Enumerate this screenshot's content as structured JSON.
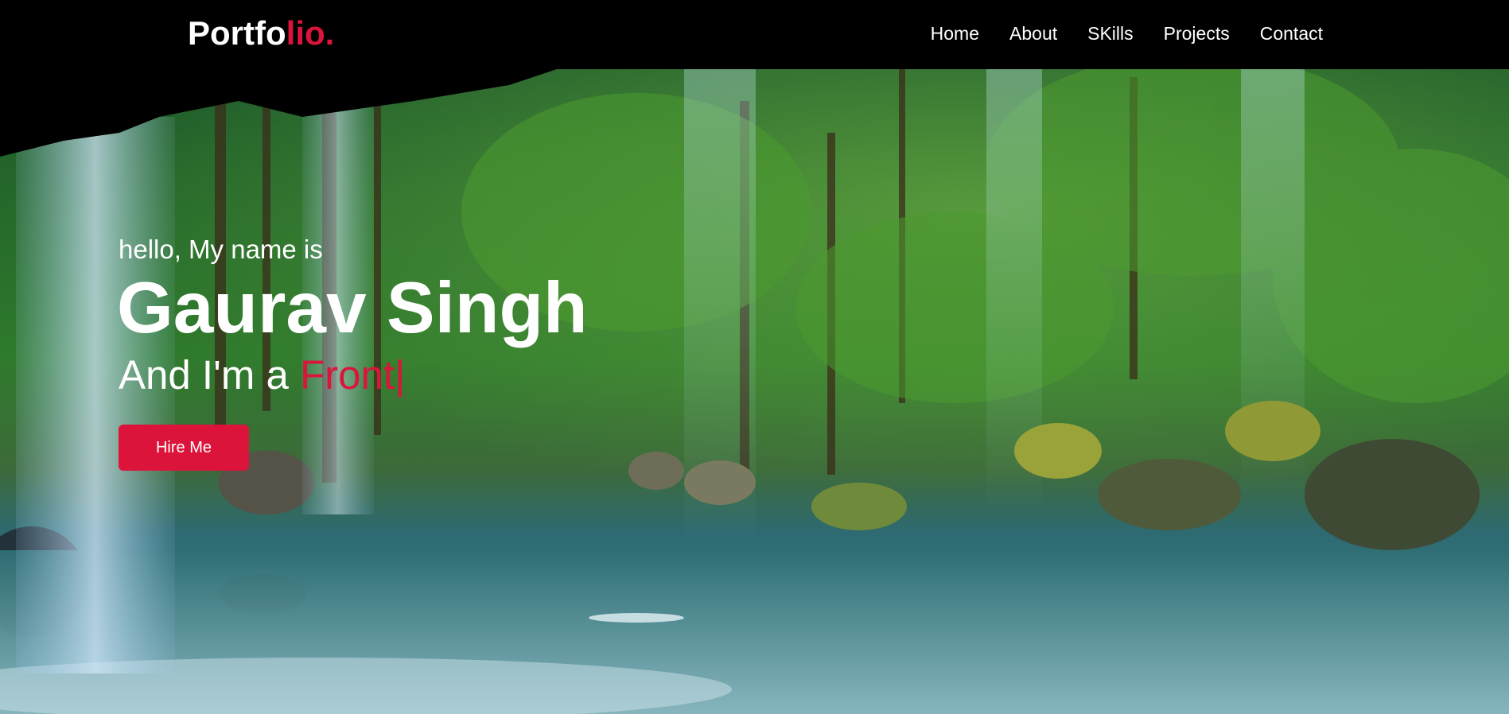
{
  "nav": {
    "brand_main": "Portfo",
    "brand_accent": "lio.",
    "links": [
      "Home",
      "About",
      "SKills",
      "Projects",
      "Contact"
    ]
  },
  "hero": {
    "greeting": "hello, My name is",
    "name": "Gaurav Singh",
    "role_prefix": "And I'm a ",
    "role_typed": "Front",
    "cursor": "|",
    "cta_label": "Hire Me"
  },
  "colors": {
    "accent": "#dc143c",
    "navbar_bg": "#000000",
    "text": "#ffffff"
  }
}
